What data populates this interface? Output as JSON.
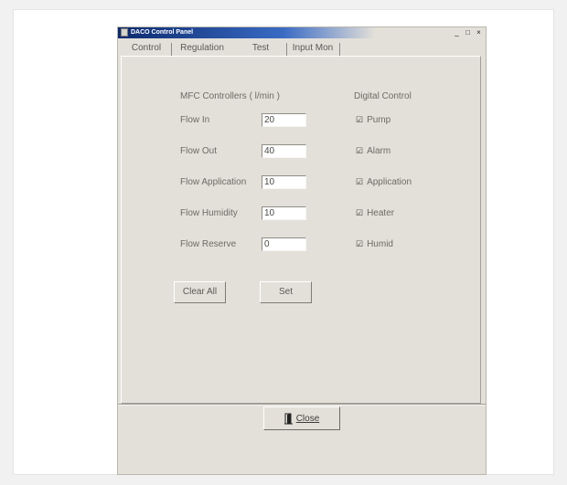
{
  "window": {
    "title": "DACO Control Panel",
    "min_label": "_",
    "max_label": "□",
    "close_label": "×"
  },
  "tabs": [
    {
      "label": "Control"
    },
    {
      "label": "Regulation"
    },
    {
      "label": "Test",
      "selected": true
    },
    {
      "label": "Input Mon"
    }
  ],
  "mfc": {
    "heading": "MFC Controllers ( l/min )",
    "rows": [
      {
        "label": "Flow In",
        "value": "20"
      },
      {
        "label": "Flow Out",
        "value": "40"
      },
      {
        "label": "Flow Application",
        "value": "10"
      },
      {
        "label": "Flow Humidity",
        "value": "10"
      },
      {
        "label": "Flow Reserve",
        "value": "0"
      }
    ]
  },
  "digital": {
    "heading": "Digital Control",
    "items": [
      {
        "label": "Pump",
        "checked": true
      },
      {
        "label": "Alarm",
        "checked": true
      },
      {
        "label": "Application",
        "checked": true
      },
      {
        "label": "Heater",
        "checked": true
      },
      {
        "label": "Humid",
        "checked": true
      }
    ],
    "check_glyph": "☑"
  },
  "buttons": {
    "clear_all": "Clear All",
    "set": "Set",
    "close": "Close"
  },
  "icons": {
    "close": "door-exit-icon"
  }
}
